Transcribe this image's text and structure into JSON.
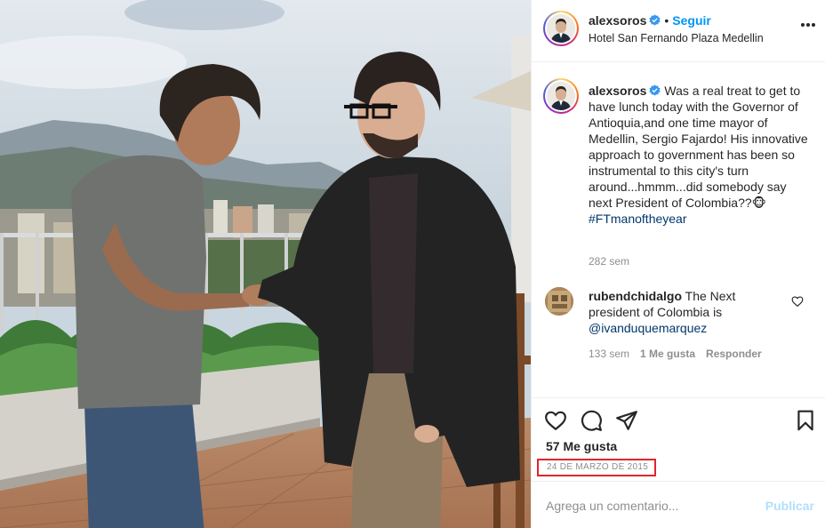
{
  "post": {
    "username": "alexsoros",
    "follow_label": "Seguir",
    "separator": "•",
    "location": "Hotel San Fernando Plaza Medellin",
    "caption_text": "Was a real treat to get to have lunch today with the Governor of Antioquia,and one time mayor of Medellin, Sergio Fajardo! His innovative approach to government has been so instrumental to this city's turn around...hmmm...did somebody say next President of Colombia??🐵",
    "caption_hashtag": "#FTmanoftheyear",
    "caption_age": "282 sem",
    "likes_label": "57 Me gusta",
    "date": "24 DE MARZO DE 2015",
    "add_comment_placeholder": "Agrega un comentario...",
    "publish_label": "Publicar"
  },
  "comment": {
    "username": "rubendchidalgo",
    "text": "The Next president of Colombia is",
    "mention": "@ivanduquemarquez",
    "age": "133 sem",
    "likes": "1 Me gusta",
    "reply_label": "Responder"
  },
  "icons": {
    "verified": "verified-badge-icon",
    "more": "more-options-icon",
    "like": "heart-icon",
    "comment": "comment-bubble-icon",
    "share": "paper-plane-icon",
    "save": "bookmark-icon",
    "comment_like": "small-heart-icon"
  },
  "colors": {
    "follow": "#0095f6",
    "link": "#00376b",
    "muted": "#8e8e8e",
    "publish_disabled": "#b2dffc",
    "date_highlight": "#e0262b"
  }
}
